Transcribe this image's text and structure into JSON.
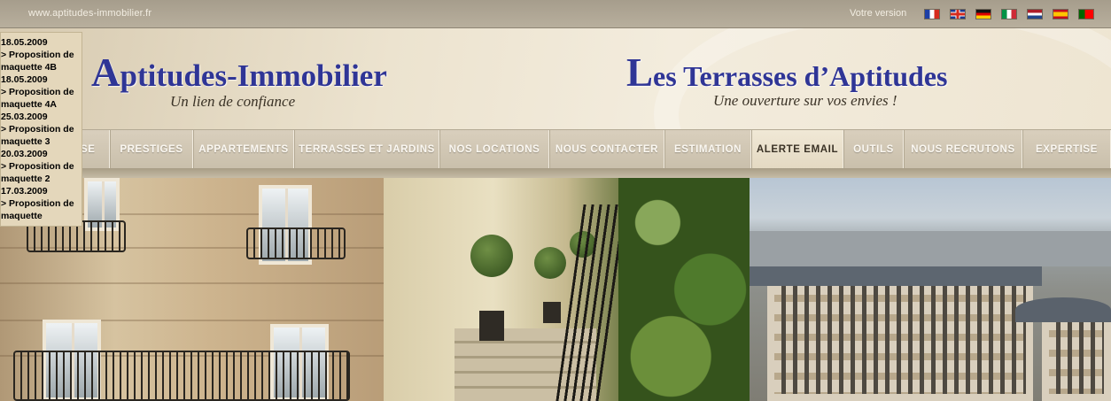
{
  "topbar": {
    "url": "www.aptitudes-immobilier.fr",
    "version_label": "Votre version",
    "flags": [
      {
        "icon": "flag-france-icon"
      },
      {
        "icon": "flag-uk-icon"
      },
      {
        "icon": "flag-germany-icon"
      },
      {
        "icon": "flag-italy-icon"
      },
      {
        "icon": "flag-netherlands-icon"
      },
      {
        "icon": "flag-spain-icon"
      },
      {
        "icon": "flag-portugal-icon"
      }
    ]
  },
  "header": {
    "left_brand_initial": "A",
    "left_brand_rest": "ptitudes-Immobilier",
    "left_tagline": "Un lien de confiance",
    "right_brand_initial": "L",
    "right_brand_rest": "es Terrasses d’Aptitudes",
    "right_tagline": "Une ouverture sur vos envies !",
    "brand_color": "#2f3596"
  },
  "nav": {
    "items": [
      {
        "label": "SE"
      },
      {
        "label": "PRESTIGES"
      },
      {
        "label": "APPARTEMENTS"
      },
      {
        "label": "TERRASSES ET JARDINS"
      },
      {
        "label": "NOS LOCATIONS"
      },
      {
        "label": "NOUS CONTACTER"
      },
      {
        "label": "ESTIMATION"
      },
      {
        "label": "ALERTE EMAIL"
      },
      {
        "label": "OUTILS"
      },
      {
        "label": "NOUS RECRUTONS"
      },
      {
        "label": "EXPERTISE"
      }
    ],
    "active": "ALERTE EMAIL"
  },
  "version_list": [
    {
      "date": "18.05.2009",
      "link": "> Proposition de maquette 4B"
    },
    {
      "date": "18.05.2009",
      "link": "> Proposition de maquette 4A"
    },
    {
      "date": "25.03.2009",
      "link": "> Proposition de maquette 3"
    },
    {
      "date": "20.03.2009",
      "link": "> Proposition de maquette 2"
    },
    {
      "date": "17.03.2009",
      "link": "> Proposition de maquette"
    }
  ]
}
